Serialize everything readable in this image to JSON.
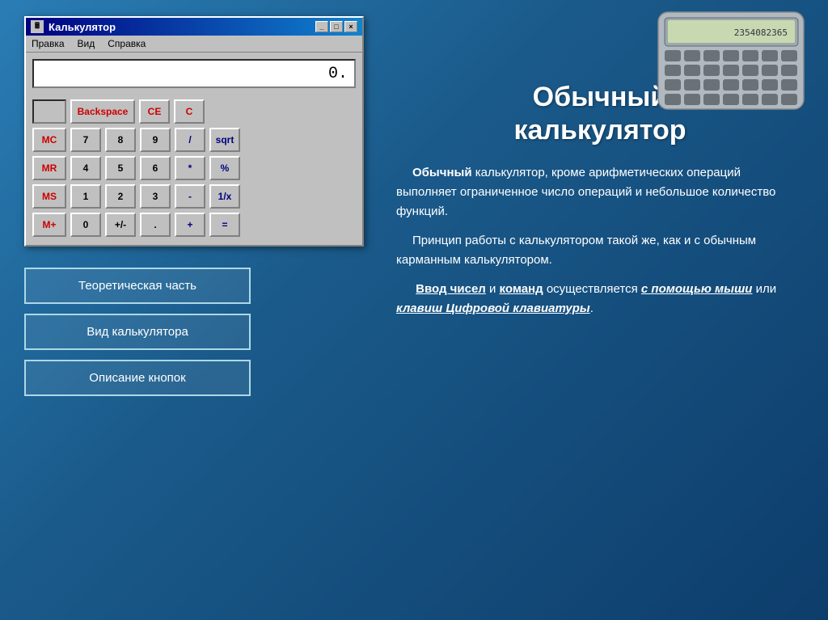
{
  "window": {
    "title": "Калькулятор",
    "menu": [
      "Правка",
      "Вид",
      "Справка"
    ],
    "titlebar_buttons": [
      "_",
      "□",
      "×"
    ],
    "display_value": "0."
  },
  "calculator": {
    "row1": {
      "empty": "",
      "backspace": "Backspace",
      "ce": "CE",
      "c": "C"
    },
    "row2": {
      "mc": "MC",
      "n7": "7",
      "n8": "8",
      "n9": "9",
      "div": "/",
      "sqrt": "sqrt"
    },
    "row3": {
      "mr": "MR",
      "n4": "4",
      "n5": "5",
      "n6": "6",
      "mul": "*",
      "pct": "%"
    },
    "row4": {
      "ms": "MS",
      "n1": "1",
      "n2": "2",
      "n3": "3",
      "sub": "-",
      "inv": "1/x"
    },
    "row5": {
      "mplus": "M+",
      "n0": "0",
      "pm": "+/-",
      "dot": ".",
      "add": "+",
      "eq": "="
    }
  },
  "nav_buttons": {
    "btn1": "Теоретическая часть",
    "btn2": "Вид калькулятора",
    "btn3": "Описание кнопок"
  },
  "right": {
    "title_line1": "Обычный",
    "title_line2": "калькулятор",
    "para1": " Обычный калькулятор, кроме арифметических операций выполняет ограниченное число операций и небольшое количество функций.",
    "para2": " Принцип работы с калькулятором такой же, как и с обычным карманным калькулятором.",
    "para3_prefix": " ",
    "para3_link1": "Ввод чисел",
    "para3_mid1": " и ",
    "para3_link2": "команд",
    "para3_mid2": " осуществляется ",
    "para3_link3": "с помощью мыши",
    "para3_mid3": " или ",
    "para3_link4": "клавиш Цифровой клавиатуры",
    "para3_end": "."
  }
}
